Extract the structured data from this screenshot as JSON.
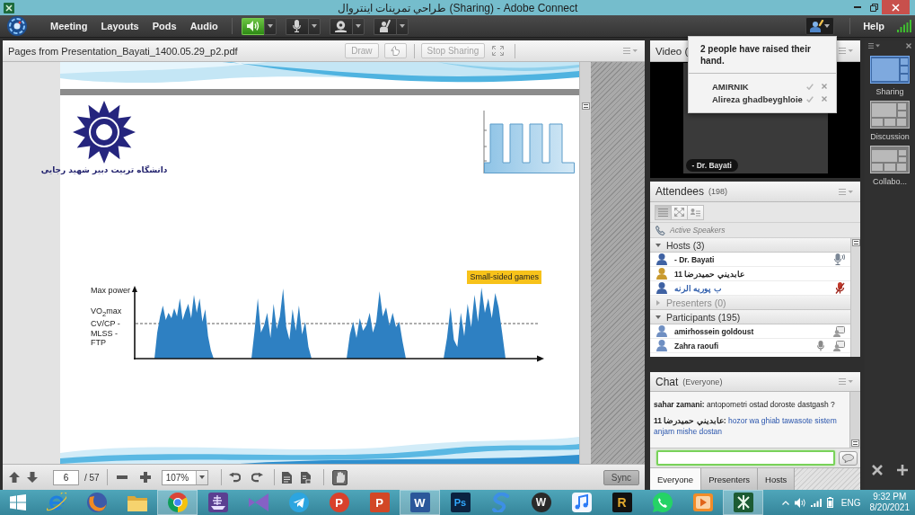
{
  "window": {
    "title": "طراحي تمرينات اينتروال (Sharing) - Adobe Connect"
  },
  "menu_bar": {
    "menus": [
      "Meeting",
      "Layouts",
      "Pods",
      "Audio"
    ],
    "devices": [
      {
        "kind": "speaker",
        "on": true
      },
      {
        "kind": "microphone",
        "on": false
      },
      {
        "kind": "camera",
        "on": false
      },
      {
        "kind": "hand",
        "on": false
      }
    ],
    "help": "Help"
  },
  "hand_popup": {
    "message": "2 people have raised their hand.",
    "people": [
      "AMIRNIK",
      "Alireza ghadbeyghloie"
    ]
  },
  "share_pod": {
    "title": "Pages from Presentation_Bayati_1400.05.29_p2.pdf",
    "draw_button": {
      "label": "Draw",
      "disabled": true
    },
    "stop_button": {
      "label": "Stop Sharing",
      "disabled": true
    },
    "slide": {
      "logo_text": "دانشگاه تربیت دبیر شهید رجایی",
      "tag": "Small-sided games",
      "y_labels": [
        "Max power",
        "VO$_{2}$max",
        "CV/CP -",
        "MLSS -",
        "FTP"
      ]
    },
    "toolbar": {
      "page": "6",
      "total": "/ 57",
      "zoom": "107%",
      "sync": "Sync"
    }
  },
  "video_pod": {
    "title": "Video (",
    "speaker": "- Dr. Bayati"
  },
  "attendees_pod": {
    "title": "Attendees",
    "count": "(198)",
    "views": [
      {
        "kind": "list",
        "selected": true
      },
      {
        "kind": "grid",
        "selected": false
      },
      {
        "kind": "roles",
        "selected": false
      }
    ],
    "active_speakers": "Active Speakers",
    "groups": [
      {
        "label": "Hosts (3)",
        "expanded": true,
        "members": [
          {
            "name": "- Dr. Bayati",
            "color": "#3f62a3",
            "self": false,
            "status": [
              {
                "kind": "speaking"
              }
            ]
          },
          {
            "name": "11 عابديني حميدرضا",
            "color": "#c99a2e",
            "self": false
          },
          {
            "name": "ب پوريه الرنه",
            "color": "#3f62a3",
            "self": true,
            "status": [
              {
                "kind": "mic-blocked"
              }
            ]
          }
        ]
      },
      {
        "label": "Presenters (0)",
        "expanded": false
      },
      {
        "label": "Participants (195)",
        "expanded": true,
        "members": [
          {
            "name": "amirhossein goldoust",
            "color": "#6f8fc2",
            "self": false,
            "status": [
              {
                "kind": "device"
              }
            ]
          },
          {
            "name": "Zahra raoufi",
            "color": "#6f8fc2",
            "self": false,
            "status": [
              {
                "kind": "mic"
              },
              {
                "kind": "device"
              }
            ]
          }
        ]
      }
    ]
  },
  "chat_pod": {
    "title": "Chat",
    "audience": "(Everyone)",
    "messages": [
      {
        "sender": "sahar zamani:",
        "text": "antopometri ostad doroste dastgash ?",
        "host": false
      },
      {
        "sender": "11 عابديني حميدرضا:",
        "text": "hozor wa ghiab tawasote sistem anjam mishe dostan",
        "host": true
      }
    ],
    "tabs": [
      {
        "label": "Everyone",
        "selected": true
      },
      {
        "label": "Presenters",
        "selected": false
      },
      {
        "label": "Hosts",
        "selected": false
      }
    ]
  },
  "layouts": {
    "items": [
      {
        "kind": "sharing",
        "label": "Sharing",
        "selected": true
      },
      {
        "kind": "discussion",
        "label": "Discussion",
        "selected": false
      },
      {
        "kind": "collaboration",
        "label": "Collabo...",
        "selected": false
      }
    ]
  },
  "taskbar": {
    "apps": [
      {
        "kind": "ie",
        "active": false
      },
      {
        "kind": "firefox",
        "active": false
      },
      {
        "kind": "folder",
        "active": false
      },
      {
        "kind": "chrome",
        "active": true
      },
      {
        "kind": "ship",
        "active": false
      },
      {
        "kind": "vs",
        "active": false
      },
      {
        "kind": "telegram",
        "active": false
      },
      {
        "kind": "p-circle",
        "glyph": "P",
        "active": false
      },
      {
        "kind": "powerpoint",
        "glyph": "P",
        "active": false
      },
      {
        "kind": "word",
        "glyph": "W",
        "active": true
      },
      {
        "kind": "photoshop",
        "glyph": "Ps",
        "active": false
      },
      {
        "kind": "s-app",
        "active": false
      },
      {
        "kind": "w-circle",
        "glyph": "W",
        "active": false
      },
      {
        "kind": "music",
        "active": false
      },
      {
        "kind": "r-tile",
        "glyph": "R",
        "active": false
      },
      {
        "kind": "whatsapp",
        "active": false
      },
      {
        "kind": "player",
        "active": false
      },
      {
        "kind": "connect",
        "active": true
      }
    ],
    "tray": {
      "language": "ENG",
      "time": "9:32 PM",
      "date": "8/20/2021"
    }
  }
}
